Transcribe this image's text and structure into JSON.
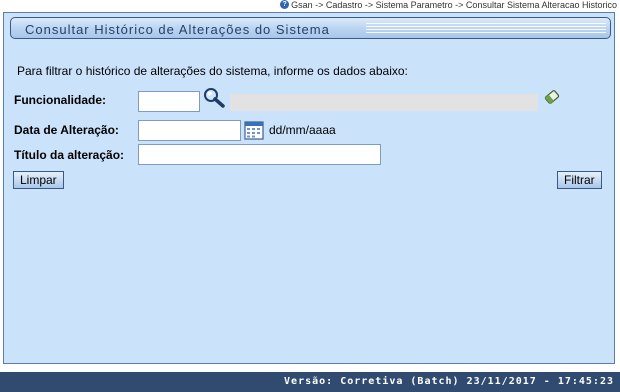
{
  "breadcrumb": {
    "help_icon": "help-icon",
    "text": "Gsan -> Cadastro -> Sistema Parametro -> Consultar Sistema Alteracao Historico"
  },
  "panel": {
    "title": "Consultar Histórico de Alterações do Sistema",
    "intro": "Para filtrar o histórico de alterações do sistema, informe os dados abaixo:"
  },
  "form": {
    "funcionalidade_label": "Funcionalidade:",
    "funcionalidade_value": "",
    "funcionalidade_desc": "",
    "data_label": "Data de Alteração:",
    "data_value": "",
    "data_format": "dd/mm/aaaa",
    "titulo_label": "Título da alteração:",
    "titulo_value": ""
  },
  "buttons": {
    "limpar": "Limpar",
    "filtrar": "Filtrar"
  },
  "icons": {
    "search": "magnifier-search-icon",
    "eraser": "eraser-icon",
    "calendar": "calendar-icon"
  },
  "footer": {
    "version": "Versão: Corretiva (Batch) 23/11/2017 - 17:45:23"
  },
  "colors": {
    "panel_bg": "#cbe2fb",
    "footer_bg": "#304a70",
    "title_text": "#26406a"
  }
}
